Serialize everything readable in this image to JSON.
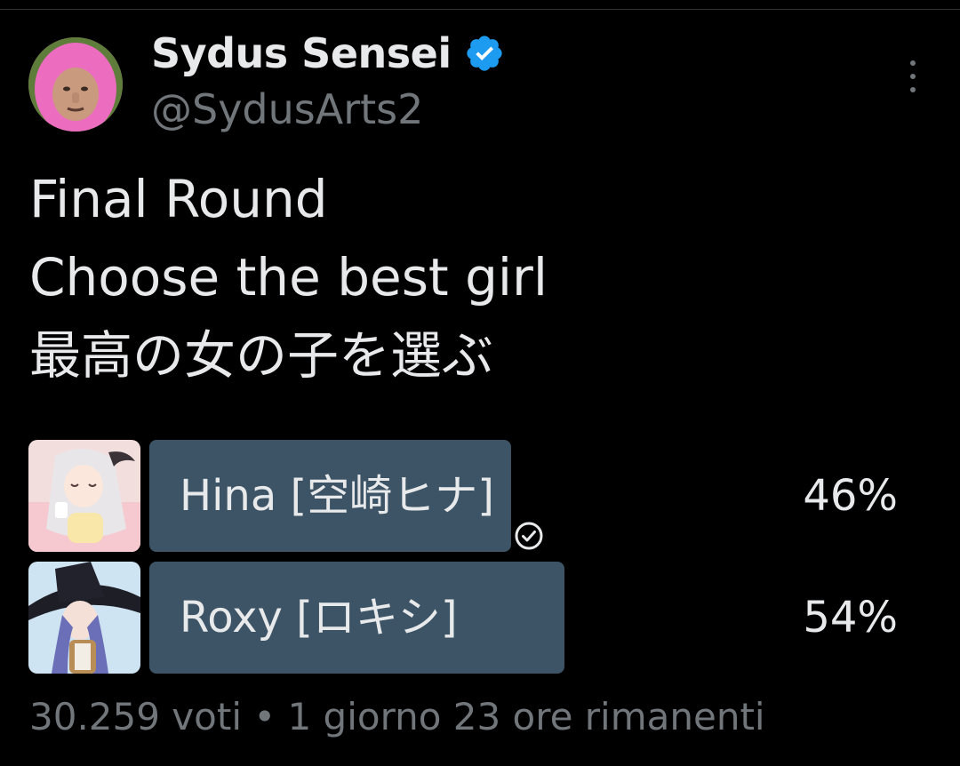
{
  "author": {
    "display_name": "Sydus Sensei",
    "handle": "@SydusArts2",
    "verified": true,
    "avatar_icon": "avatar-pink-hood"
  },
  "tweet": {
    "lines": [
      "Final Round",
      "Choose the best girl",
      "最高の女の子を選ぶ"
    ]
  },
  "poll": {
    "options": [
      {
        "label": "Hina [空崎ヒナ]",
        "percent_text": "46%",
        "percent": 46,
        "voted": true,
        "thumb_icon": "hina-thumbnail"
      },
      {
        "label": "Roxy [ロキシ]",
        "percent_text": "54%",
        "percent": 54,
        "voted": false,
        "thumb_icon": "roxy-thumbnail"
      }
    ],
    "footer": "30.259 voti • 1 giorno 23 ore rimanenti"
  },
  "colors": {
    "background": "#000000",
    "text": "#e7e9ea",
    "secondary_text": "#71767b",
    "poll_bar": "#3d5466",
    "verified_badge": "#1d9bf0"
  }
}
